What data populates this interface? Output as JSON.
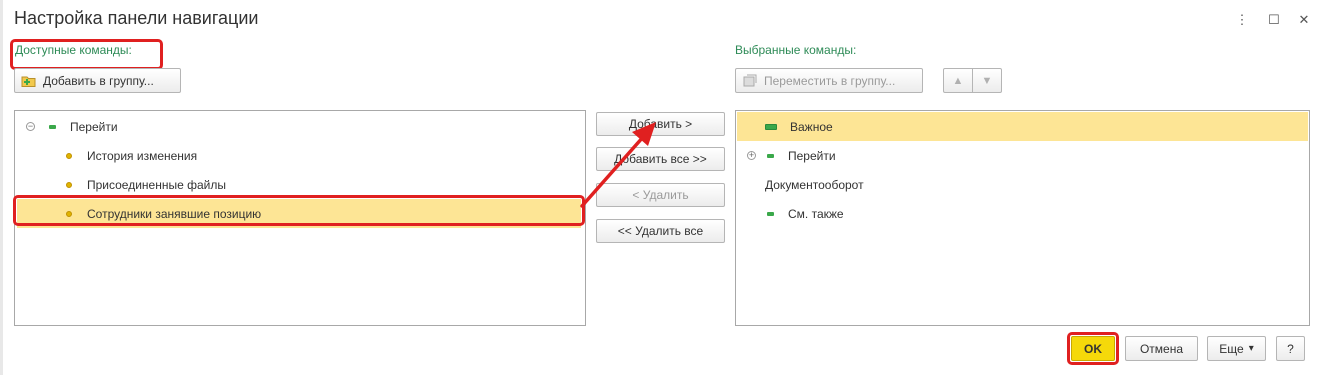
{
  "window": {
    "title": "Настройка панели навигации",
    "menu_icon": "⋮",
    "maximize_icon": "☐",
    "close_icon": "✕"
  },
  "available": {
    "label": "Доступные команды:",
    "add_to_group_label": "Добавить в группу...",
    "tree": [
      {
        "label": "Перейти",
        "toggle": "−"
      },
      {
        "label": "История изменения"
      },
      {
        "label": "Присоединенные файлы"
      },
      {
        "label": "Сотрудники занявшие позицию"
      }
    ]
  },
  "middle": {
    "add_label": "Добавить >",
    "add_all_label": "Добавить все >>",
    "remove_label": "< Удалить",
    "remove_all_label": "<< Удалить все"
  },
  "selected": {
    "label": "Выбранные команды:",
    "move_to_group_label": "Переместить в группу...",
    "up_icon": "▲",
    "down_icon": "▼",
    "tree": [
      {
        "label": "Важное"
      },
      {
        "label": "Перейти",
        "toggle": "+"
      },
      {
        "label": "Документооборот"
      },
      {
        "label": "См. также"
      }
    ]
  },
  "footer": {
    "ok_label": "OK",
    "cancel_label": "Отмена",
    "more_label": "Еще",
    "more_caret": "▾",
    "help_label": "?"
  },
  "colors": {
    "accent_green": "#2e8b57",
    "selection_yellow": "#fde595",
    "ok_yellow": "#f5d90a",
    "highlight_red": "#e02020"
  }
}
